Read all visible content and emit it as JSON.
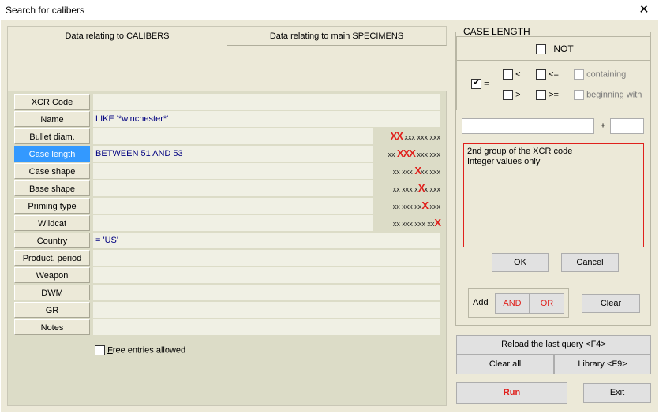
{
  "window": {
    "title": "Search for calibers",
    "close_glyph": "✕"
  },
  "tabs": [
    {
      "label": "Data relating to CALIBERS",
      "active": true
    },
    {
      "label": "Data relating to main SPECIMENS",
      "active": false
    }
  ],
  "fields": [
    {
      "label": "XCR Code",
      "value": ""
    },
    {
      "label": "Name",
      "value": "LIKE '*winchester*'"
    },
    {
      "label": "Bullet diam.",
      "value": "",
      "xcr_pre": "",
      "xcr_x": "XX",
      "xcr_post": " xxx xxx xxx"
    },
    {
      "label": "Case length",
      "value": "BETWEEN 51 AND 53",
      "xcr_pre": "xx ",
      "xcr_x": "XXX",
      "xcr_post": " xxx xxx"
    },
    {
      "label": "Case shape",
      "value": "",
      "xcr_pre": "xx xxx ",
      "xcr_x": "X",
      "xcr_post": "xx xxx"
    },
    {
      "label": "Base shape",
      "value": "",
      "xcr_pre": "xx xxx x",
      "xcr_x": "X",
      "xcr_post": "x xxx"
    },
    {
      "label": "Priming type",
      "value": "",
      "xcr_pre": "xx xxx xx",
      "xcr_x": "X",
      "xcr_post": " xxx"
    },
    {
      "label": "Wildcat",
      "value": "",
      "xcr_pre": "xx xxx xxx xx",
      "xcr_x": "X",
      "xcr_post": ""
    },
    {
      "label": "Country",
      "value": "= 'US'"
    },
    {
      "label": "Product. period",
      "value": ""
    },
    {
      "label": "Weapon",
      "value": ""
    },
    {
      "label": "DWM",
      "value": ""
    },
    {
      "label": "GR",
      "value": ""
    },
    {
      "label": "Notes",
      "value": ""
    }
  ],
  "free_entries": {
    "label_u": "F",
    "label_rest": "ree entries allowed",
    "checked": false
  },
  "case_length": {
    "title": "CASE LENGTH",
    "not_label": "NOT",
    "eq_label": "=",
    "lt_label": "<",
    "le_label": "<=",
    "gt_label": ">",
    "ge_label": ">=",
    "containing_label": "containing",
    "beginning_label": "beginning with",
    "plusminus": "±",
    "hint_line1": "2nd group of the XCR code",
    "hint_line2": "Integer values only",
    "ok_label": "OK",
    "cancel_label": "Cancel"
  },
  "add_group": {
    "add_label": "Add",
    "and_label": "AND",
    "or_label": "OR",
    "clear_label": "Clear"
  },
  "bottom": {
    "reload_label": "Reload the last query    <F4>",
    "clear_all_label": "Clear all",
    "library_label": "Library   <F9>",
    "run_label": "Run",
    "exit_label": "Exit"
  },
  "colors": {
    "accent": "#e0201c",
    "selected": "#3399ff",
    "value_text": "#000080"
  }
}
